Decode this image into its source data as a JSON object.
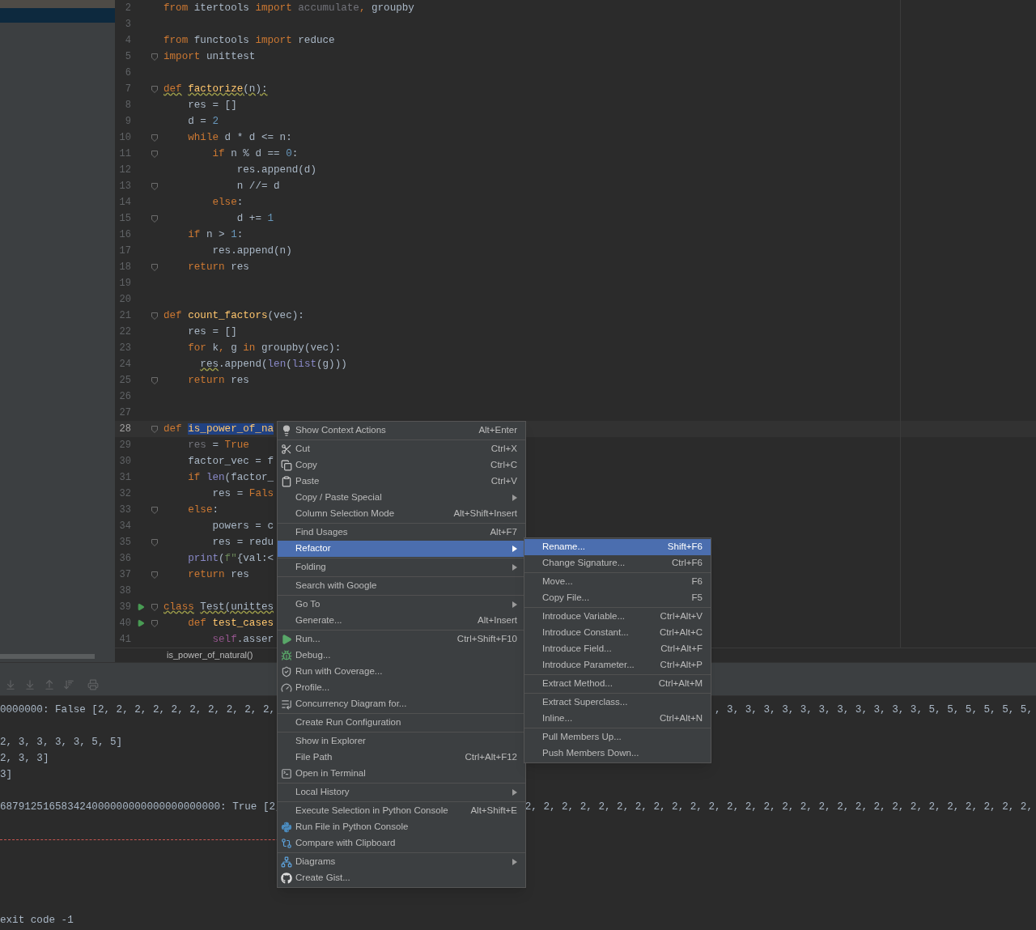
{
  "editor": {
    "lines": [
      {
        "number": "2",
        "current": false,
        "fold": false,
        "run": false,
        "tokens": [
          {
            "text": "from",
            "kind": "kw"
          },
          {
            "text": " itertools ",
            "kind": "name"
          },
          {
            "text": "import",
            "kind": "kw"
          },
          {
            "text": " accumulate",
            "kind": "dim"
          },
          {
            "text": ",",
            "kind": "kw"
          },
          {
            "text": " groupby",
            "kind": "name"
          }
        ]
      },
      {
        "number": "3",
        "current": false,
        "fold": false,
        "run": false
      },
      {
        "number": "4",
        "current": false,
        "fold": false,
        "run": false,
        "tokens": [
          {
            "text": "from",
            "kind": "kw"
          },
          {
            "text": " functools ",
            "kind": "name"
          },
          {
            "text": "import",
            "kind": "kw"
          },
          {
            "text": " reduce",
            "kind": "name"
          }
        ]
      },
      {
        "number": "5",
        "current": false,
        "fold": true,
        "run": false,
        "tokens": [
          {
            "text": "import",
            "kind": "kw"
          },
          {
            "text": " unittest",
            "kind": "name"
          }
        ]
      },
      {
        "number": "6",
        "current": false,
        "fold": false,
        "run": false
      },
      {
        "number": "7",
        "current": false,
        "fold": true,
        "run": false,
        "tokens": [
          {
            "text": "def",
            "kind": "kw",
            "warning": true
          },
          {
            "text": " factorize",
            "kind": "func",
            "warning": true
          },
          {
            "text": "(n):",
            "kind": "name",
            "warning": true
          }
        ]
      },
      {
        "number": "8",
        "current": false,
        "fold": false,
        "run": false,
        "tokens": [
          {
            "text": "    res = []",
            "kind": "name"
          }
        ]
      },
      {
        "number": "9",
        "current": false,
        "fold": false,
        "run": false,
        "tokens": [
          {
            "text": "    d = ",
            "kind": "name"
          },
          {
            "text": "2",
            "kind": "num"
          }
        ]
      },
      {
        "number": "10",
        "current": false,
        "fold": true,
        "run": false,
        "tokens": [
          {
            "text": "    while",
            "kind": "kw"
          },
          {
            "text": " d * d <= n:",
            "kind": "name"
          }
        ]
      },
      {
        "number": "11",
        "current": false,
        "fold": true,
        "run": false,
        "tokens": [
          {
            "text": "        if",
            "kind": "kw"
          },
          {
            "text": " n % d == ",
            "kind": "name"
          },
          {
            "text": "0",
            "kind": "num"
          },
          {
            "text": ":",
            "kind": "name"
          }
        ]
      },
      {
        "number": "12",
        "current": false,
        "fold": false,
        "run": false,
        "tokens": [
          {
            "text": "            res.append(d)",
            "kind": "name"
          }
        ]
      },
      {
        "number": "13",
        "current": false,
        "fold": true,
        "run": false,
        "tokens": [
          {
            "text": "            n //= d",
            "kind": "name"
          }
        ]
      },
      {
        "number": "14",
        "current": false,
        "fold": false,
        "run": false,
        "tokens": [
          {
            "text": "        else",
            "kind": "kw"
          },
          {
            "text": ":",
            "kind": "name"
          }
        ]
      },
      {
        "number": "15",
        "current": false,
        "fold": true,
        "run": false,
        "tokens": [
          {
            "text": "            d += ",
            "kind": "name"
          },
          {
            "text": "1",
            "kind": "num"
          }
        ]
      },
      {
        "number": "16",
        "current": false,
        "fold": false,
        "run": false,
        "tokens": [
          {
            "text": "    if",
            "kind": "kw"
          },
          {
            "text": " n > ",
            "kind": "name"
          },
          {
            "text": "1",
            "kind": "num"
          },
          {
            "text": ":",
            "kind": "name"
          }
        ]
      },
      {
        "number": "17",
        "current": false,
        "fold": false,
        "run": false,
        "tokens": [
          {
            "text": "        res.append(n)",
            "kind": "name"
          }
        ]
      },
      {
        "number": "18",
        "current": false,
        "fold": true,
        "run": false,
        "tokens": [
          {
            "text": "    return",
            "kind": "kw"
          },
          {
            "text": " res",
            "kind": "name"
          }
        ]
      },
      {
        "number": "19",
        "current": false,
        "fold": false,
        "run": false
      },
      {
        "number": "20",
        "current": false,
        "fold": false,
        "run": false
      },
      {
        "number": "21",
        "current": false,
        "fold": true,
        "run": false,
        "tokens": [
          {
            "text": "def",
            "kind": "kw"
          },
          {
            "text": " count_factors",
            "kind": "func"
          },
          {
            "text": "(vec):",
            "kind": "name"
          }
        ]
      },
      {
        "number": "22",
        "current": false,
        "fold": false,
        "run": false,
        "tokens": [
          {
            "text": "    res = []",
            "kind": "name"
          }
        ]
      },
      {
        "number": "23",
        "current": false,
        "fold": false,
        "run": false,
        "tokens": [
          {
            "text": "    for",
            "kind": "kw"
          },
          {
            "text": " k",
            "kind": "name"
          },
          {
            "text": ",",
            "kind": "kw"
          },
          {
            "text": " g ",
            "kind": "name"
          },
          {
            "text": "in",
            "kind": "kw"
          },
          {
            "text": " groupby(vec):",
            "kind": "name"
          }
        ]
      },
      {
        "number": "24",
        "current": false,
        "fold": false,
        "run": false,
        "tokens": [
          {
            "text": "      res",
            "kind": "name",
            "warning": true
          },
          {
            "text": ".append(",
            "kind": "name"
          },
          {
            "text": "len",
            "kind": "builtin"
          },
          {
            "text": "(",
            "kind": "name"
          },
          {
            "text": "list",
            "kind": "builtin"
          },
          {
            "text": "(g)))",
            "kind": "name"
          }
        ]
      },
      {
        "number": "25",
        "current": false,
        "fold": true,
        "run": false,
        "tokens": [
          {
            "text": "    return",
            "kind": "kw"
          },
          {
            "text": " res",
            "kind": "name"
          }
        ]
      },
      {
        "number": "26",
        "current": false,
        "fold": false,
        "run": false
      },
      {
        "number": "27",
        "current": false,
        "fold": false,
        "run": false
      },
      {
        "number": "28",
        "current": true,
        "fold": true,
        "run": false,
        "tokens": [
          {
            "text": "def ",
            "kind": "kw"
          },
          {
            "text": "is_power_of_na",
            "kind": "func",
            "selected": true
          }
        ]
      },
      {
        "number": "29",
        "current": false,
        "fold": false,
        "run": false,
        "tokens": [
          {
            "text": "    res",
            "kind": "dim"
          },
          {
            "text": " = ",
            "kind": "name"
          },
          {
            "text": "True",
            "kind": "kw"
          }
        ]
      },
      {
        "number": "30",
        "current": false,
        "fold": false,
        "run": false,
        "tokens": [
          {
            "text": "    factor_vec = f",
            "kind": "name"
          }
        ]
      },
      {
        "number": "31",
        "current": false,
        "fold": false,
        "run": false,
        "tokens": [
          {
            "text": "    if ",
            "kind": "kw"
          },
          {
            "text": "len",
            "kind": "builtin"
          },
          {
            "text": "(factor_",
            "kind": "name"
          }
        ]
      },
      {
        "number": "32",
        "current": false,
        "fold": false,
        "run": false,
        "tokens": [
          {
            "text": "        res = ",
            "kind": "name"
          },
          {
            "text": "Fals",
            "kind": "kw"
          }
        ]
      },
      {
        "number": "33",
        "current": false,
        "fold": true,
        "run": false,
        "tokens": [
          {
            "text": "    else",
            "kind": "kw"
          },
          {
            "text": ":",
            "kind": "name"
          }
        ]
      },
      {
        "number": "34",
        "current": false,
        "fold": false,
        "run": false,
        "tokens": [
          {
            "text": "        powers = c",
            "kind": "name"
          }
        ]
      },
      {
        "number": "35",
        "current": false,
        "fold": true,
        "run": false,
        "tokens": [
          {
            "text": "        res = redu",
            "kind": "name"
          }
        ]
      },
      {
        "number": "36",
        "current": false,
        "fold": false,
        "run": false,
        "tokens": [
          {
            "text": "    print",
            "kind": "builtin"
          },
          {
            "text": "(",
            "kind": "name"
          },
          {
            "text": "f\"",
            "kind": "str"
          },
          {
            "text": "{val:<",
            "kind": "name"
          }
        ]
      },
      {
        "number": "37",
        "current": false,
        "fold": true,
        "run": false,
        "tokens": [
          {
            "text": "    return",
            "kind": "kw"
          },
          {
            "text": " res",
            "kind": "name"
          }
        ]
      },
      {
        "number": "38",
        "current": false,
        "fold": false,
        "run": false
      },
      {
        "number": "39",
        "current": false,
        "fold": true,
        "run": true,
        "tokens": [
          {
            "text": "class",
            "kind": "kw",
            "warning": true
          },
          {
            "text": " Test(unittes",
            "kind": "name",
            "warning": true
          }
        ]
      },
      {
        "number": "40",
        "current": false,
        "fold": true,
        "run": true,
        "tokens": [
          {
            "text": "    def",
            "kind": "kw"
          },
          {
            "text": " test_cases",
            "kind": "func"
          }
        ]
      },
      {
        "number": "41",
        "current": false,
        "fold": false,
        "run": false,
        "tokens": [
          {
            "text": "        self",
            "kind": "self"
          },
          {
            "text": ".asser",
            "kind": "name"
          }
        ]
      }
    ],
    "breadcrumb": "is_power_of_natural()"
  },
  "console": {
    "lines": [
      {
        "kind": "text",
        "text": "0000000: False [2, 2, 2, 2, 2, 2, 2, 2, 2, 2,",
        "right_text": ", 3, 3, 3, 3, 3, 3, 3, 3, 3, 3, 3, 5, 5, 5, 5, 5, 5,"
      },
      {
        "kind": "blank"
      },
      {
        "kind": "text",
        "text": "2, 3, 3, 3, 3, 5, 5]"
      },
      {
        "kind": "text",
        "text": "2, 3, 3]"
      },
      {
        "kind": "text",
        "text": "3]"
      },
      {
        "kind": "blank"
      },
      {
        "kind": "text",
        "text": "687912516583424000000000000000000000: True [2,",
        "right_text": "2, 2, 2, 2, 2, 2, 2, 2, 2, 2, 2, 2, 2, 2, 2, 2, 2, 2, 2, 2, 2, 2, 2, 2, 2, 2, 2, 2,"
      },
      {
        "kind": "blank"
      },
      {
        "kind": "rule"
      },
      {
        "kind": "blank"
      },
      {
        "kind": "blank"
      },
      {
        "kind": "blank"
      },
      {
        "kind": "blank"
      },
      {
        "kind": "text",
        "text": "exit code -1"
      }
    ]
  },
  "context_menu": {
    "groups": [
      [
        {
          "label": "Show Context Actions",
          "shortcut": "Alt+Enter",
          "kind": "bulb",
          "submenu": false,
          "selected": false
        }
      ],
      [
        {
          "label": "Cut",
          "shortcut": "Ctrl+X",
          "kind": "scissors",
          "submenu": false,
          "selected": false
        },
        {
          "label": "Copy",
          "shortcut": "Ctrl+C",
          "kind": "copy",
          "submenu": false,
          "selected": false
        },
        {
          "label": "Paste",
          "shortcut": "Ctrl+V",
          "kind": "paste",
          "submenu": false,
          "selected": false
        },
        {
          "label": "Copy / Paste Special",
          "submenu": true,
          "selected": false
        },
        {
          "label": "Column Selection Mode",
          "shortcut": "Alt+Shift+Insert",
          "submenu": false,
          "selected": false
        }
      ],
      [
        {
          "label": "Find Usages",
          "shortcut": "Alt+F7",
          "submenu": false,
          "selected": false
        },
        {
          "label": "Refactor",
          "submenu": true,
          "selected": true
        }
      ],
      [
        {
          "label": "Folding",
          "submenu": true,
          "selected": false
        }
      ],
      [
        {
          "label": "Search with Google",
          "submenu": false,
          "selected": false
        }
      ],
      [
        {
          "label": "Go To",
          "submenu": true,
          "selected": false
        },
        {
          "label": "Generate...",
          "shortcut": "Alt+Insert",
          "submenu": false,
          "selected": false
        }
      ],
      [
        {
          "label": "Run...",
          "shortcut": "Ctrl+Shift+F10",
          "kind": "run",
          "submenu": false,
          "selected": false
        },
        {
          "label": "Debug...",
          "kind": "debug",
          "submenu": false,
          "selected": false
        },
        {
          "label": "Run with Coverage...",
          "kind": "coverage",
          "submenu": false,
          "selected": false
        },
        {
          "label": "Profile...",
          "kind": "profile",
          "submenu": false,
          "selected": false
        },
        {
          "label": "Concurrency Diagram for...",
          "kind": "concurrency",
          "submenu": false,
          "selected": false
        }
      ],
      [
        {
          "label": "Create Run Configuration",
          "submenu": false,
          "selected": false
        }
      ],
      [
        {
          "label": "Show in Explorer",
          "submenu": false,
          "selected": false
        },
        {
          "label": "File Path",
          "shortcut": "Ctrl+Alt+F12",
          "submenu": false,
          "selected": false
        },
        {
          "label": "Open in Terminal",
          "kind": "terminal",
          "submenu": false,
          "selected": false
        }
      ],
      [
        {
          "label": "Local History",
          "submenu": true,
          "selected": false
        }
      ],
      [
        {
          "label": "Execute Selection in Python Console",
          "shortcut": "Alt+Shift+E",
          "submenu": false,
          "selected": false
        },
        {
          "label": "Run File in Python Console",
          "kind": "python",
          "submenu": false,
          "selected": false
        },
        {
          "label": "Compare with Clipboard",
          "kind": "compare",
          "submenu": false,
          "selected": false
        }
      ],
      [
        {
          "label": "Diagrams",
          "kind": "diagrams",
          "submenu": true,
          "selected": false
        },
        {
          "label": "Create Gist...",
          "kind": "github",
          "submenu": false,
          "selected": false
        }
      ]
    ]
  },
  "refactor_submenu": {
    "groups": [
      [
        {
          "label": "Rename...",
          "shortcut": "Shift+F6",
          "selected": true
        },
        {
          "label": "Change Signature...",
          "shortcut": "Ctrl+F6",
          "selected": false
        }
      ],
      [
        {
          "label": "Move...",
          "shortcut": "F6",
          "selected": false
        },
        {
          "label": "Copy File...",
          "shortcut": "F5",
          "selected": false
        }
      ],
      [
        {
          "label": "Introduce Variable...",
          "shortcut": "Ctrl+Alt+V",
          "selected": false
        },
        {
          "label": "Introduce Constant...",
          "shortcut": "Ctrl+Alt+C",
          "selected": false
        },
        {
          "label": "Introduce Field...",
          "shortcut": "Ctrl+Alt+F",
          "selected": false
        },
        {
          "label": "Introduce Parameter...",
          "shortcut": "Ctrl+Alt+P",
          "selected": false
        }
      ],
      [
        {
          "label": "Extract Method...",
          "shortcut": "Ctrl+Alt+M",
          "selected": false
        }
      ],
      [
        {
          "label": "Extract Superclass...",
          "selected": false
        },
        {
          "label": "Inline...",
          "shortcut": "Ctrl+Alt+N",
          "selected": false
        }
      ],
      [
        {
          "label": "Pull Members Up...",
          "selected": false
        },
        {
          "label": "Push Members Down...",
          "selected": false
        }
      ]
    ]
  }
}
